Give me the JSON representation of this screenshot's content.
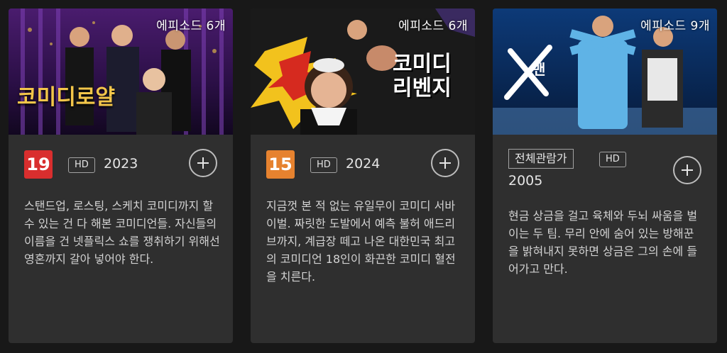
{
  "cards": [
    {
      "thumb_title": "코미디로얄",
      "episodes": "에피소드 6개",
      "rating": "19",
      "rating_color": "#d92e2e",
      "hd": "HD",
      "year": "2023",
      "description": "스탠드업, 로스팅, 스케치 코미디까지 할 수 있는 건 다 해본 코미디언들. 자신들의 이름을 건 넷플릭스 쇼를 쟁취하기 위해선 영혼까지 갈아 넣어야 한다.",
      "add_icon": "plus-icon"
    },
    {
      "thumb_title_line1": "코미디",
      "thumb_title_line2": "리벤지",
      "episodes": "에피소드 6개",
      "rating": "15",
      "rating_color": "#e6822f",
      "hd": "HD",
      "year": "2024",
      "description": "지금껏 본 적 없는 유일무이 코미디 서바이벌. 짜릿한 도발에서 예측 불허 애드리브까지, 계급장 떼고 나온 대한민국 최고의 코미디언 18인이 화끈한 코미디 혈전을 치른다.",
      "add_icon": "plus-icon"
    },
    {
      "thumb_title": "맨",
      "episodes": "에피소드 9개",
      "rating_text": "전체관람가",
      "hd": "HD",
      "year": "2005",
      "description": "현금 상금을 걸고 육체와 두뇌 싸움을 벌이는 두 팀. 무리 안에 숨어 있는 방해꾼을 밝혀내지 못하면 상금은 그의 손에 들어가고 만다.",
      "add_icon": "plus-icon"
    }
  ]
}
